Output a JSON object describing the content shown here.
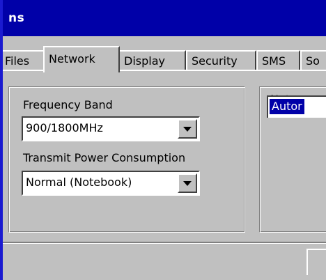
{
  "window": {
    "title": "ns"
  },
  "tabs": [
    {
      "label": "Files",
      "active": false
    },
    {
      "label": "Network",
      "active": true
    },
    {
      "label": "Display",
      "active": false
    },
    {
      "label": "Security",
      "active": false
    },
    {
      "label": "SMS",
      "active": false
    },
    {
      "label": "So",
      "active": false
    }
  ],
  "left_group": {
    "frequency_band": {
      "label": "Frequency Band",
      "value": "900/1800MHz"
    },
    "transmit_power": {
      "label": "Transmit Power Consumption",
      "value": "Normal (Notebook)"
    }
  },
  "right_group": {
    "label": "Netwo",
    "value": "Autor"
  },
  "colors": {
    "title_bar": "#0000a8",
    "face": "#c0c0c0",
    "highlight": "#ffffff",
    "shadow": "#808080",
    "selection": "#0000a8"
  }
}
